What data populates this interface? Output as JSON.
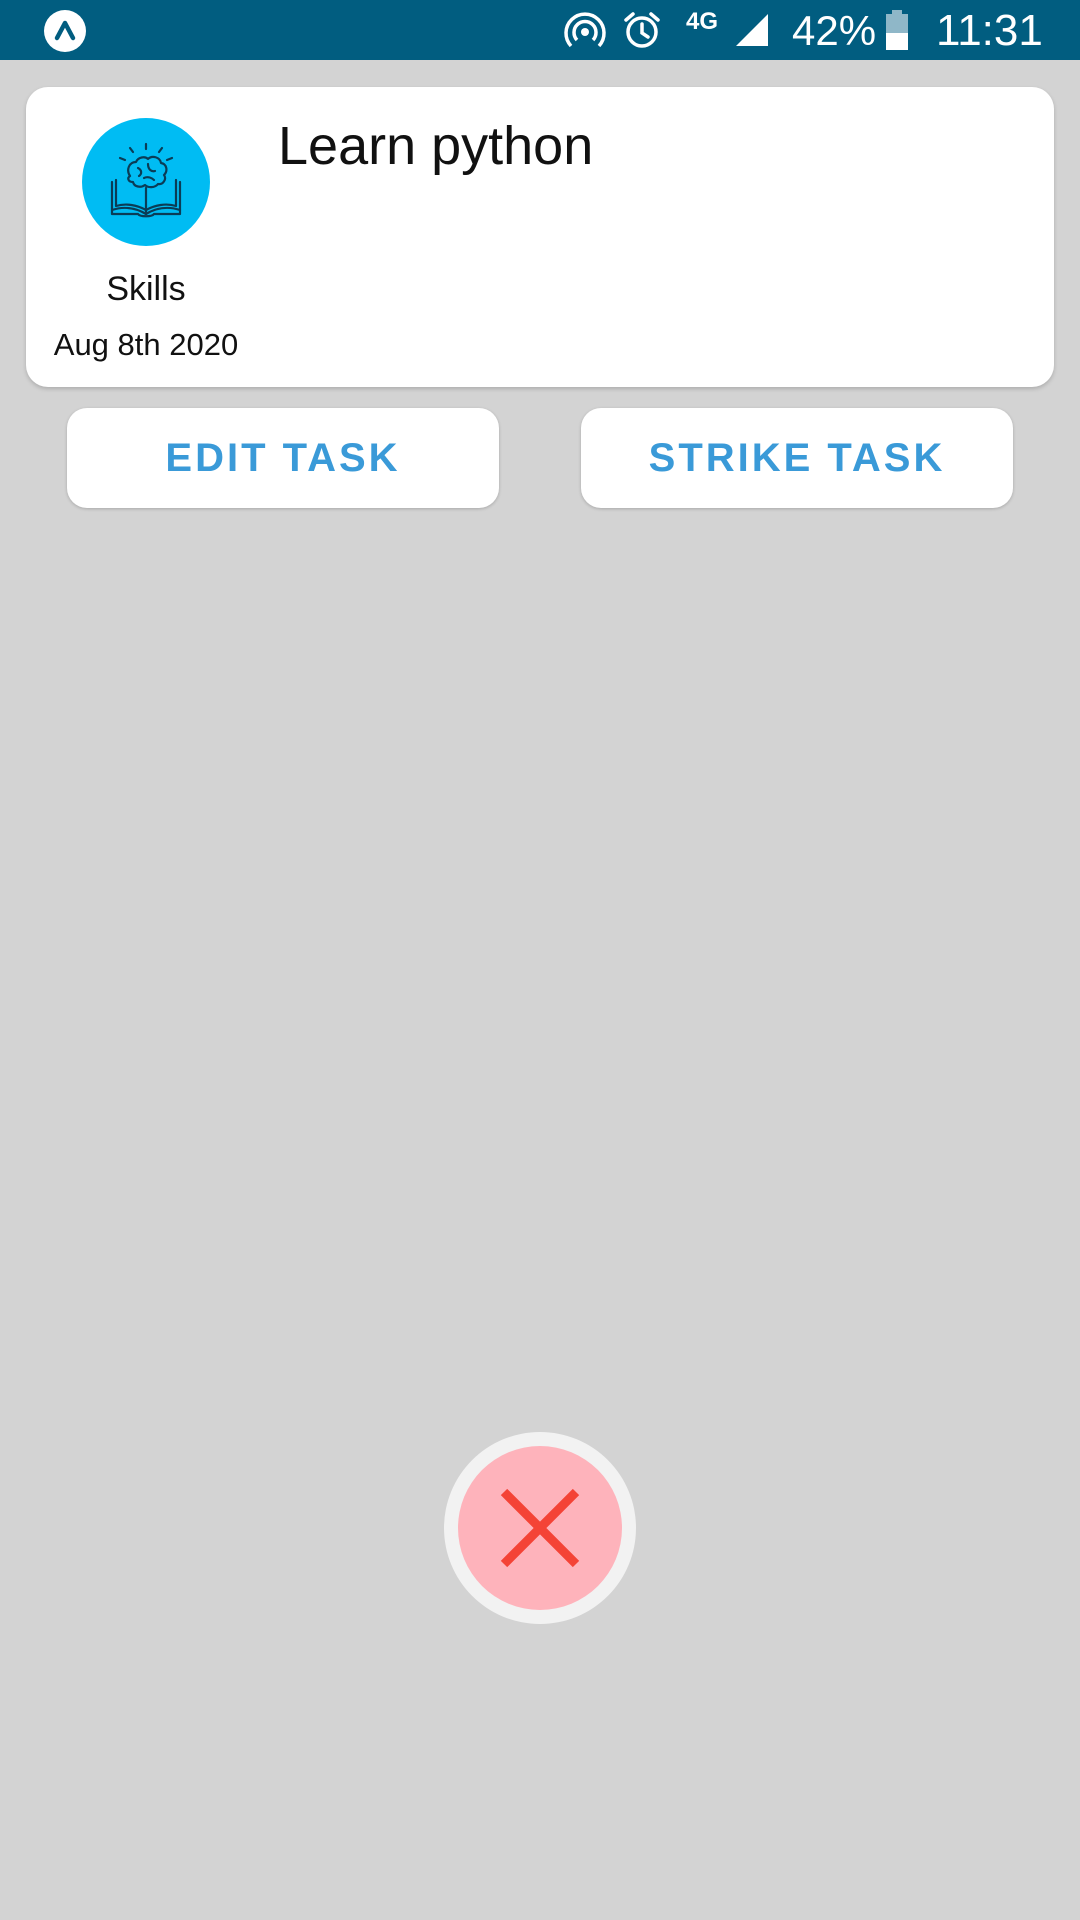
{
  "status_bar": {
    "network": "4G",
    "battery_percent": "42%",
    "time": "11:31",
    "icons": [
      "app-icon",
      "hotspot-icon",
      "alarm-icon",
      "signal-icon",
      "battery-icon"
    ]
  },
  "task": {
    "title": "Learn python",
    "category": "Skills",
    "category_icon": "brain-book-icon",
    "date": "Aug 8th 2020"
  },
  "actions": {
    "edit_label": "EDIT TASK",
    "strike_label": "STRIKE TASK",
    "close_icon": "close-icon"
  },
  "colors": {
    "status_bar": "#015d80",
    "background": "#d3d3d3",
    "accent": "#3a9ad8",
    "category_circle": "#00bcf3",
    "close_fill": "#feb3bb",
    "close_x": "#f44336"
  }
}
